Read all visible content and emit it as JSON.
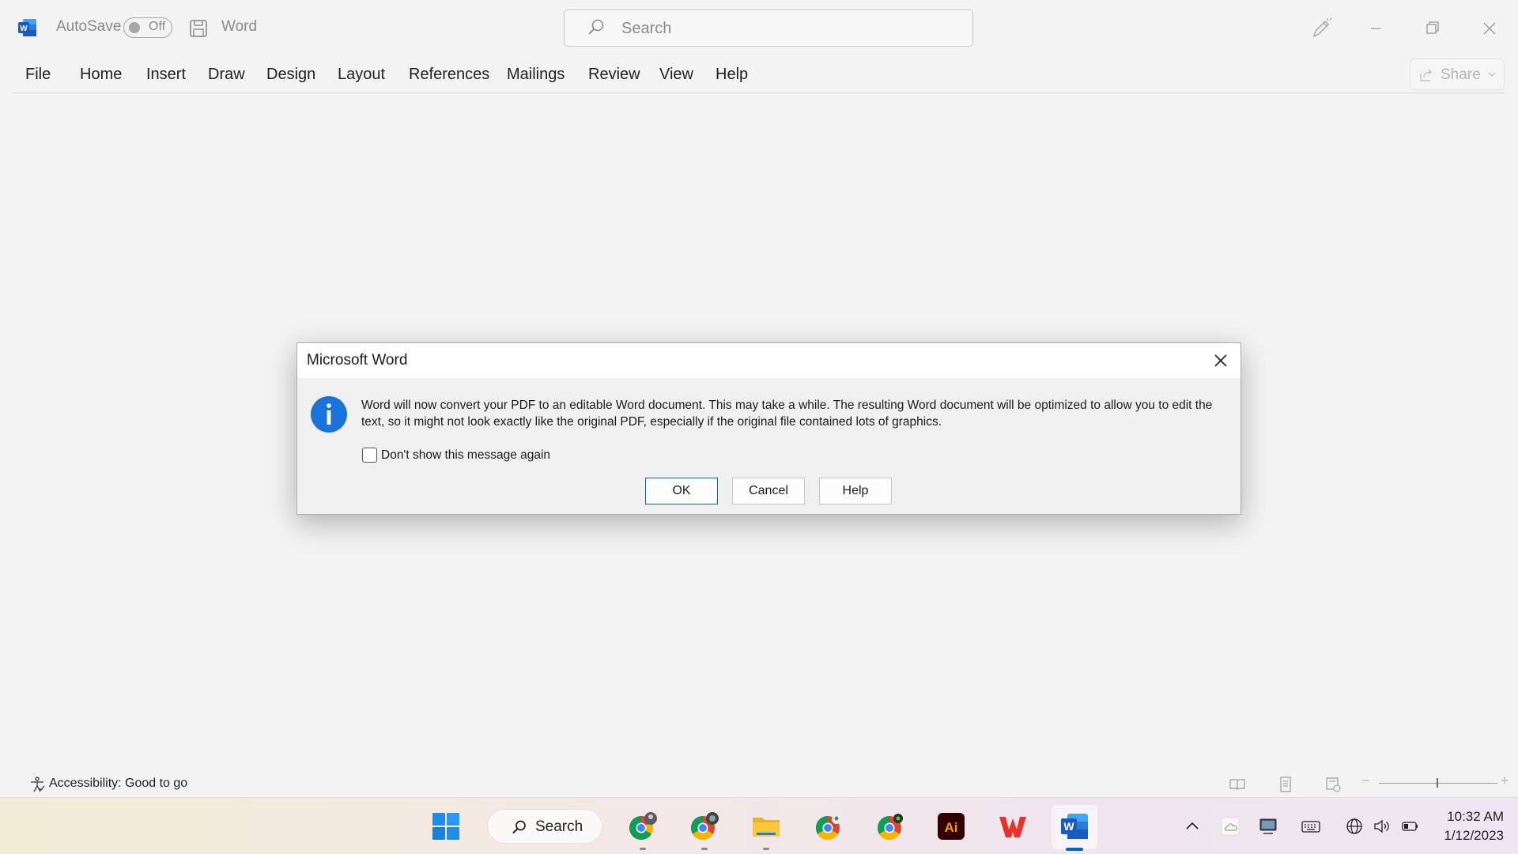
{
  "titlebar": {
    "autosave_label": "AutoSave",
    "autosave_toggle": "Off",
    "doc_title": "Word",
    "search_placeholder": "Search"
  },
  "ribbon": {
    "tabs": [
      "File",
      "Home",
      "Insert",
      "Draw",
      "Design",
      "Layout",
      "References",
      "Mailings",
      "Review",
      "View",
      "Help"
    ],
    "share_label": "Share"
  },
  "dialog": {
    "title": "Microsoft Word",
    "message": "Word will now convert your PDF to an editable Word document. This may take a while. The resulting Word document will be optimized to allow you to edit the text, so it might not look exactly like the original PDF, especially if the original file contained lots of graphics.",
    "checkbox_label": "Don't show this message again",
    "checkbox_checked": false,
    "buttons": {
      "ok": "OK",
      "cancel": "Cancel",
      "help": "Help"
    }
  },
  "statusbar": {
    "accessibility": "Accessibility: Good to go"
  },
  "taskbar": {
    "search_label": "Search",
    "apps": [
      "windows-start",
      "chrome-profile-1",
      "chrome-profile-2",
      "file-explorer",
      "chrome-profile-3",
      "chrome-profile-4",
      "adobe-illustrator",
      "wps-office",
      "microsoft-word"
    ],
    "illustrator_label": "Ai",
    "clock_time": "10:32 AM",
    "clock_date": "1/12/2023"
  },
  "colors": {
    "word_blue": "#185abd",
    "accent_blue": "#0067c0",
    "info_blue": "#1a73d9"
  }
}
